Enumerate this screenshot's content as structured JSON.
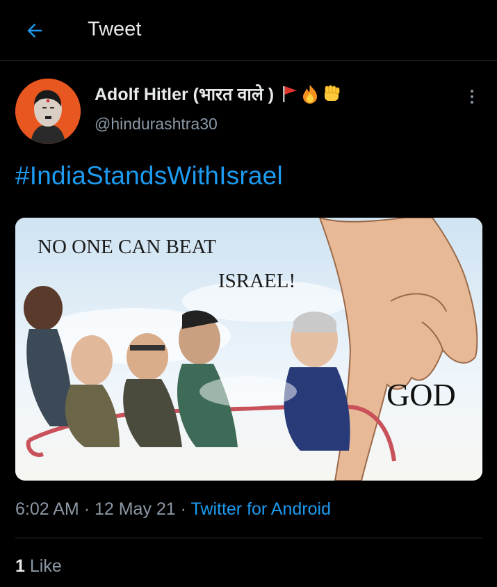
{
  "header": {
    "title": "Tweet"
  },
  "author": {
    "name": "Adolf Hitler (भारत वाले )",
    "handle": "@hindurashtra30"
  },
  "tweet": {
    "hashtag": "#IndiaStandsWithIsrael",
    "image_text": {
      "line1": "NO ONE CAN BEAT",
      "line2": "ISRAEL!",
      "god": "GOD"
    },
    "time": "6:02 AM",
    "date": "12 May 21",
    "separator": "·",
    "source": "Twitter for Android"
  },
  "stats": {
    "likes_count": "1",
    "likes_label": "Like"
  },
  "colors": {
    "accent": "#1d9bf0",
    "background": "#000000",
    "muted": "#8b98a5"
  }
}
